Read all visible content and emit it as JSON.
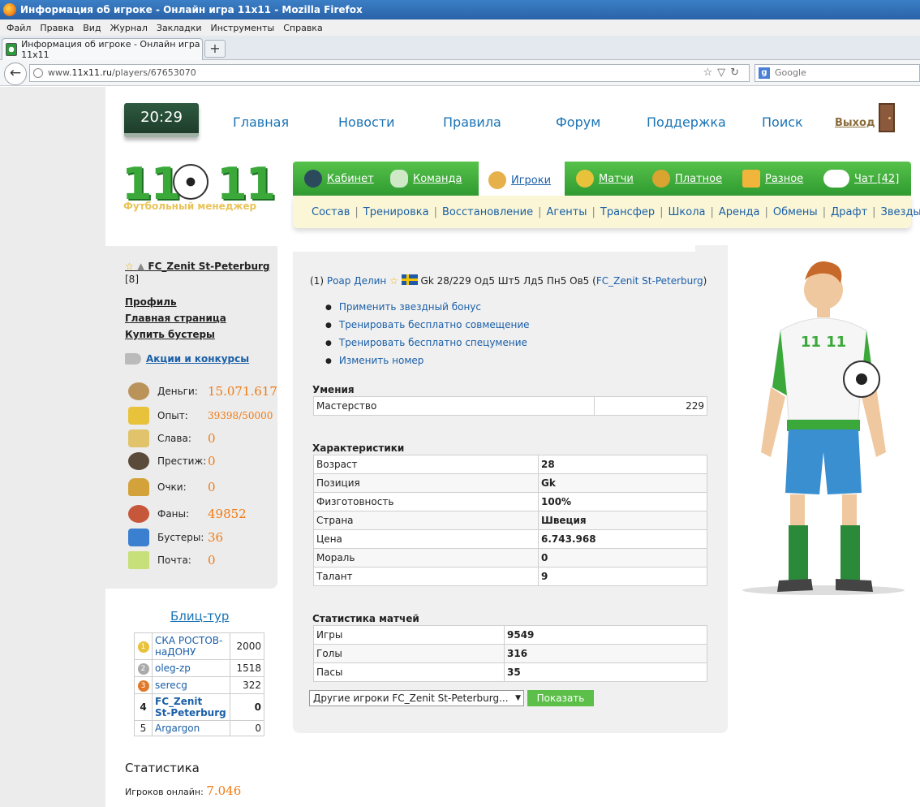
{
  "window": {
    "title": "Информация об игроке - Онлайн игра 11x11 - Mozilla Firefox"
  },
  "menu": [
    "Файл",
    "Правка",
    "Вид",
    "Журнал",
    "Закладки",
    "Инструменты",
    "Справка"
  ],
  "tab": {
    "title": "Информация об игроке - Онлайн игра 11x11",
    "new_tab": "+"
  },
  "nav": {
    "url_prefix": "www.",
    "url_domain": "11x11.ru",
    "url_path": "/players/67653070",
    "search_placeholder": "Google",
    "search_engine_icon": "g"
  },
  "site": {
    "clock": "20:29",
    "top_links": [
      "Главная",
      "Новости",
      "Правила",
      "Форум",
      "Поддержка",
      "Поиск"
    ],
    "exit": "Выход",
    "logo_left": "11",
    "logo_right": "11",
    "logo_sub": "Футбольный менеджер",
    "main_nav": [
      {
        "label": "Кабинет",
        "icon": "manager-icon"
      },
      {
        "label": "Команда",
        "icon": "stadium-icon"
      },
      {
        "label": "Игроки",
        "icon": "players-icon"
      },
      {
        "label": "Матчи",
        "icon": "trophy-ball-icon"
      },
      {
        "label": "Платное",
        "icon": "coins-icon"
      },
      {
        "label": "Разное",
        "icon": "beer-icon"
      },
      {
        "label": "Чат [42]",
        "icon": "chat-bubble-icon"
      }
    ],
    "sub_nav": [
      "Состав",
      "Тренировка",
      "Восстановление",
      "Агенты",
      "Трансфер",
      "Школа",
      "Аренда",
      "Обмены",
      "Драфт",
      "Звезды"
    ]
  },
  "sidebar": {
    "club_name": "FC_Zenit St-Peterburg",
    "club_rank": "[8]",
    "links": [
      "Профиль",
      "Главная страница",
      "Купить бустеры"
    ],
    "promo": "Акции и конкурсы",
    "stats": [
      {
        "label": "Деньги:",
        "value": "15.071.617"
      },
      {
        "label": "Опыт:",
        "value": "39398/50000"
      },
      {
        "label": "Слава:",
        "value": "0"
      },
      {
        "label": "Престиж:",
        "value": "0"
      },
      {
        "label": "Очки:",
        "value": "0"
      },
      {
        "label": "Фаны:",
        "value": "49852"
      },
      {
        "label": "Бустеры:",
        "value": "36"
      },
      {
        "label": "Почта:",
        "value": "0"
      }
    ],
    "blitz_title": "Блиц-тур",
    "blitz": [
      {
        "place": "1",
        "name_line1": "СКА РОСТОВ-",
        "name_line2": "наДОНУ",
        "score": "2000"
      },
      {
        "place": "2",
        "name": "oleg-zp",
        "score": "1518"
      },
      {
        "place": "3",
        "name": "serecg",
        "score": "322"
      },
      {
        "place": "4",
        "name_line1": "FC_Zenit",
        "name_line2": "St-Peterburg",
        "score": "0"
      },
      {
        "place": "5",
        "name": "Argargon",
        "score": "0"
      }
    ],
    "stats_title": "Статистика",
    "online_label": "Игроков онлайн:",
    "online_value": "7.046"
  },
  "player": {
    "index": "(1)",
    "name": "Роар Делин",
    "summary": "Gk 28/229 Од5 Шт5 Лд5 Пн5 Ов5",
    "team": "FC_Zenit St-Peterburg",
    "team_open": "(",
    "team_close": ")",
    "actions": [
      "Применить звездный бонус",
      "Тренировать бесплатно совмещение",
      "Тренировать бесплатно спецумение",
      "Изменить номер"
    ],
    "skills_title": "Умения",
    "skills": [
      {
        "k": "Мастерство",
        "v": "229"
      }
    ],
    "chars_title": "Характеристики",
    "chars": [
      {
        "k": "Возраст",
        "v": "28"
      },
      {
        "k": "Позиция",
        "v": "Gk"
      },
      {
        "k": "Физготовность",
        "v": "100%"
      },
      {
        "k": "Страна",
        "v": "Швеция"
      },
      {
        "k": "Цена",
        "v": "6.743.968"
      },
      {
        "k": "Мораль",
        "v": "0"
      },
      {
        "k": "Талант",
        "v": "9"
      }
    ],
    "match_title": "Статистика матчей",
    "match": [
      {
        "k": "Игры",
        "v": "9549"
      },
      {
        "k": "Голы",
        "v": "316"
      },
      {
        "k": "Пасы",
        "v": "35"
      }
    ],
    "select_value": "Другие игроки FC_Zenit St-Peterburg...",
    "show_button": "Показать"
  },
  "figure": {
    "shirt_text": "11 11"
  }
}
